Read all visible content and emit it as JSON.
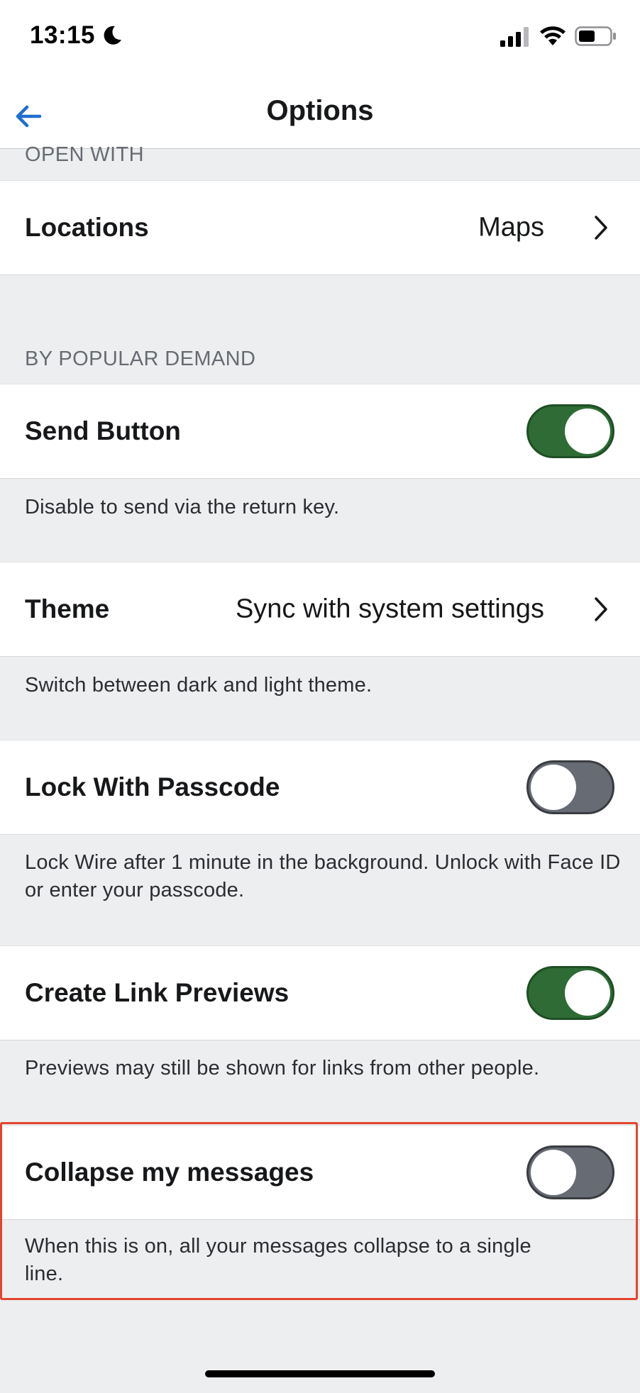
{
  "status_bar": {
    "time": "13:15",
    "icons": [
      "moon-icon",
      "signal-icon",
      "wifi-icon",
      "battery-icon"
    ]
  },
  "nav": {
    "title": "Options",
    "back_icon": "back-arrow-icon",
    "accent_color": "#1f6fcf"
  },
  "sections": {
    "open_with": {
      "header": "OPEN WITH",
      "locations": {
        "label": "Locations",
        "value": "Maps"
      }
    },
    "popular_demand": {
      "header": "BY POPULAR DEMAND",
      "send_button": {
        "label": "Send Button",
        "state": "on",
        "footer": "Disable to send via the return key."
      },
      "theme": {
        "label": "Theme",
        "value": "Sync with system settings",
        "footer": "Switch between dark and light theme."
      },
      "lock_passcode": {
        "label": "Lock With Passcode",
        "state": "off",
        "footer": "Lock Wire after 1 minute in the background. Unlock with Face ID or enter your passcode."
      },
      "link_previews": {
        "label": "Create Link Previews",
        "state": "on",
        "footer": "Previews may still be shown for links from other people."
      },
      "collapse_messages": {
        "label": "Collapse my messages",
        "state": "off",
        "footer": "When this is on, all your messages collapse to a single line."
      }
    }
  },
  "colors": {
    "toggle_on": "#2e6b35",
    "toggle_off": "#676b73",
    "highlight": "#e2452e",
    "background": "#edeef0"
  }
}
